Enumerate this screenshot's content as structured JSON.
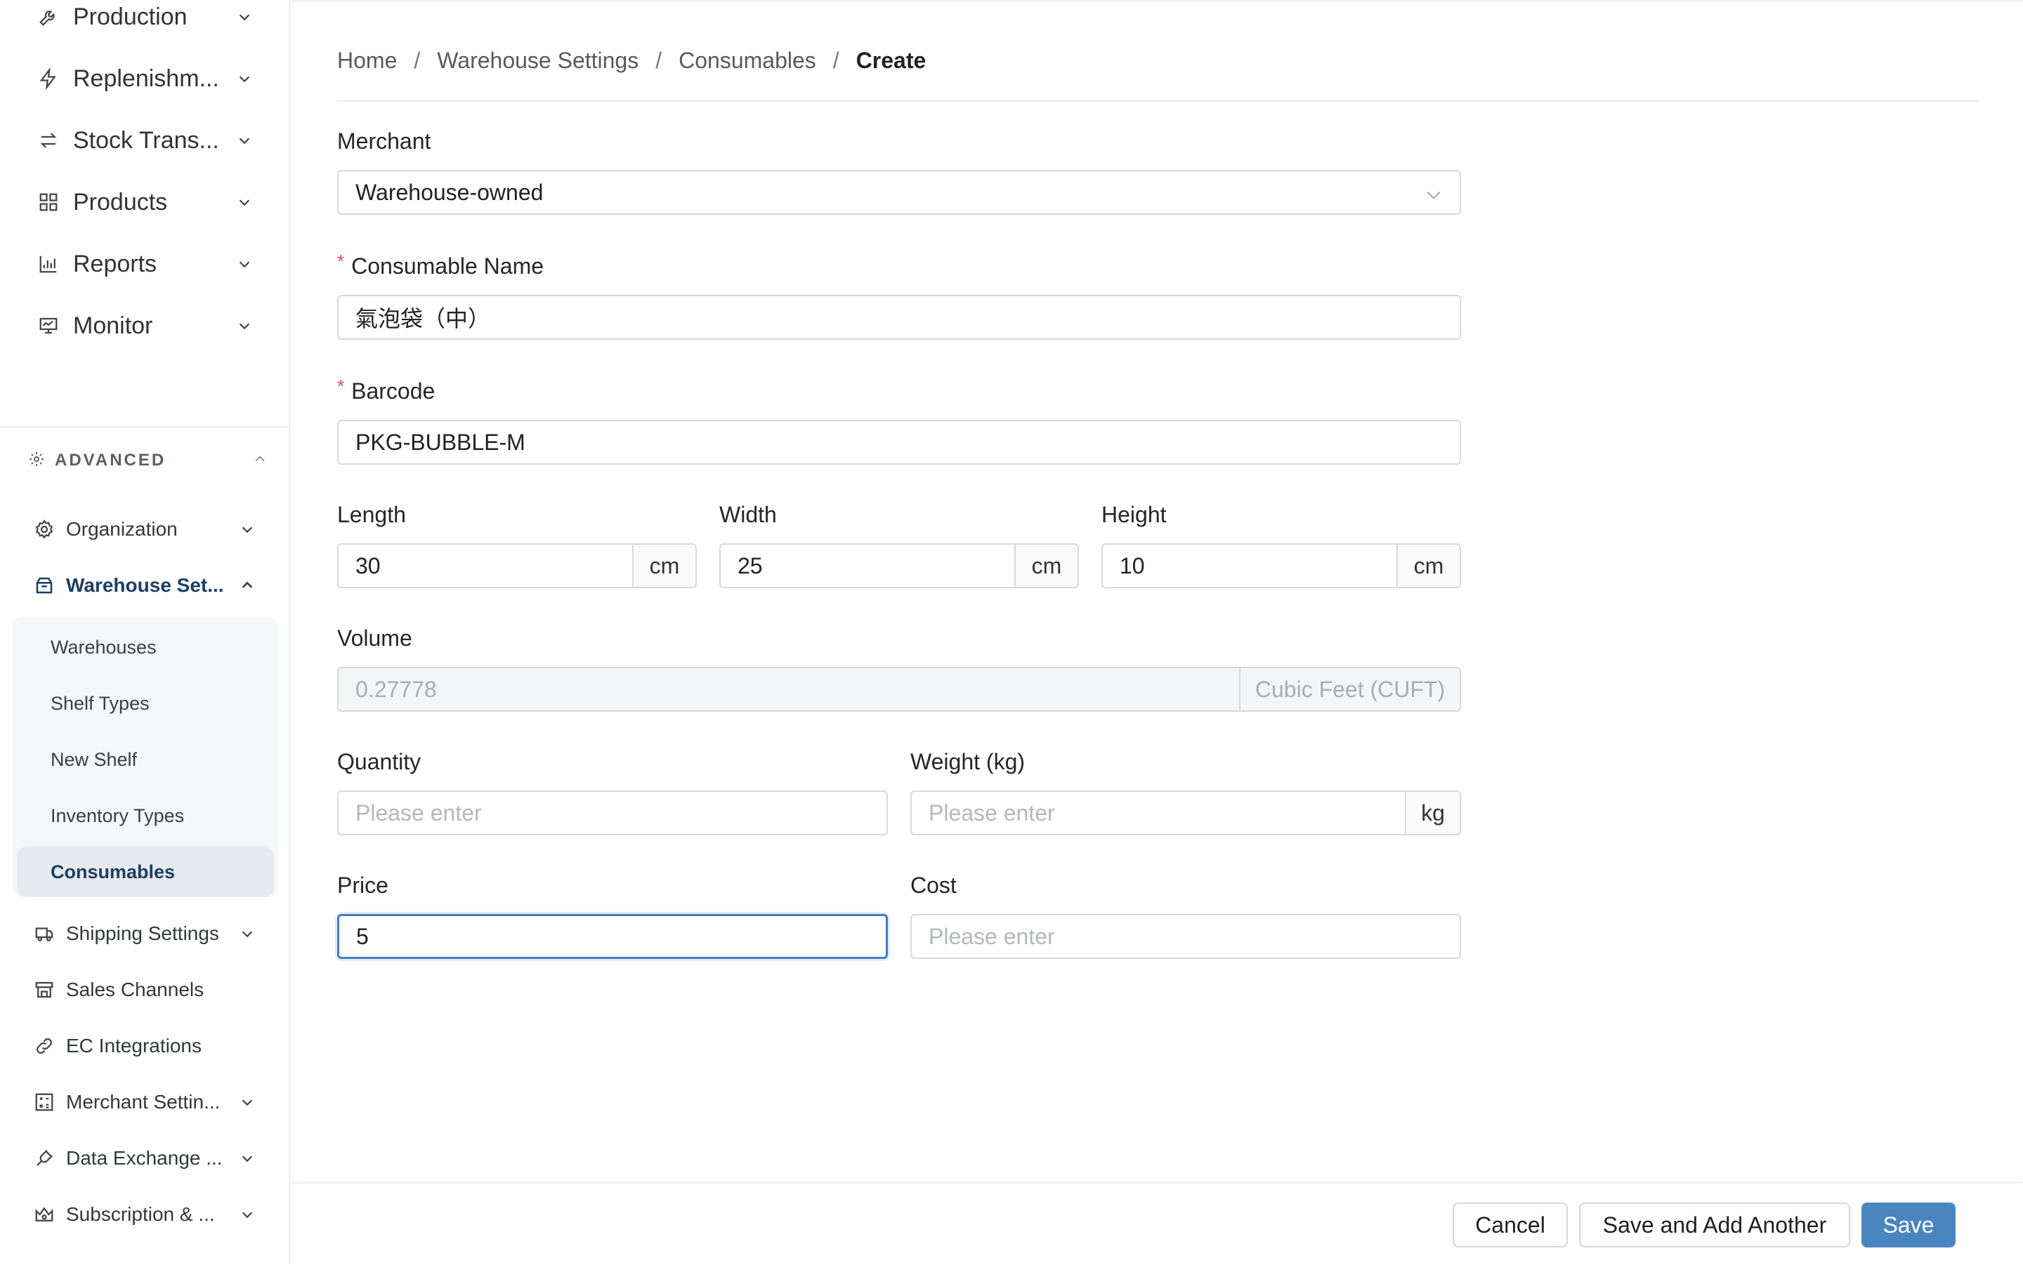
{
  "sidebar": {
    "top_items": [
      {
        "label": "Production",
        "icon": "wrench-icon"
      },
      {
        "label": "Replenishm...",
        "icon": "lightning-icon"
      },
      {
        "label": "Stock Trans...",
        "icon": "transfer-icon"
      },
      {
        "label": "Products",
        "icon": "grid-icon"
      },
      {
        "label": "Reports",
        "icon": "bar-chart-icon"
      },
      {
        "label": "Monitor",
        "icon": "monitor-icon"
      }
    ],
    "advanced_label": "ADVANCED",
    "advanced_items": {
      "organization": "Organization",
      "warehouse_settings": "Warehouse Set...",
      "sub_items": [
        "Warehouses",
        "Shelf Types",
        "New Shelf",
        "Inventory Types",
        "Consumables"
      ],
      "shipping_settings": "Shipping Settings",
      "sales_channels": "Sales Channels",
      "ec_integrations": "EC Integrations",
      "merchant_settings": "Merchant Settin...",
      "data_exchange": "Data Exchange ...",
      "subscription": "Subscription & ..."
    }
  },
  "breadcrumb": {
    "home": "Home",
    "warehouse_settings": "Warehouse Settings",
    "consumables": "Consumables",
    "current": "Create",
    "separator": "/"
  },
  "form": {
    "merchant": {
      "label": "Merchant",
      "value": "Warehouse-owned"
    },
    "consumable_name": {
      "label": "Consumable Name",
      "value": "氣泡袋（中）",
      "required": "*"
    },
    "barcode": {
      "label": "Barcode",
      "value": "PKG-BUBBLE-M",
      "required": "*"
    },
    "length": {
      "label": "Length",
      "value": "30",
      "unit": "cm"
    },
    "width": {
      "label": "Width",
      "value": "25",
      "unit": "cm"
    },
    "height": {
      "label": "Height",
      "value": "10",
      "unit": "cm"
    },
    "volume": {
      "label": "Volume",
      "value": "0.27778",
      "unit": "Cubic Feet (CUFT)"
    },
    "quantity": {
      "label": "Quantity",
      "placeholder": "Please enter"
    },
    "weight": {
      "label": "Weight (kg)",
      "placeholder": "Please enter",
      "unit": "kg"
    },
    "price": {
      "label": "Price",
      "value": "5"
    },
    "cost": {
      "label": "Cost",
      "placeholder": "Please enter"
    }
  },
  "footer": {
    "cancel": "Cancel",
    "save_and_add": "Save and Add Another",
    "save": "Save"
  },
  "colors": {
    "primary": "#4a85c0",
    "active_nav": "#1d3f63",
    "required": "#e5484d",
    "focus_border": "#3f7dc1"
  }
}
